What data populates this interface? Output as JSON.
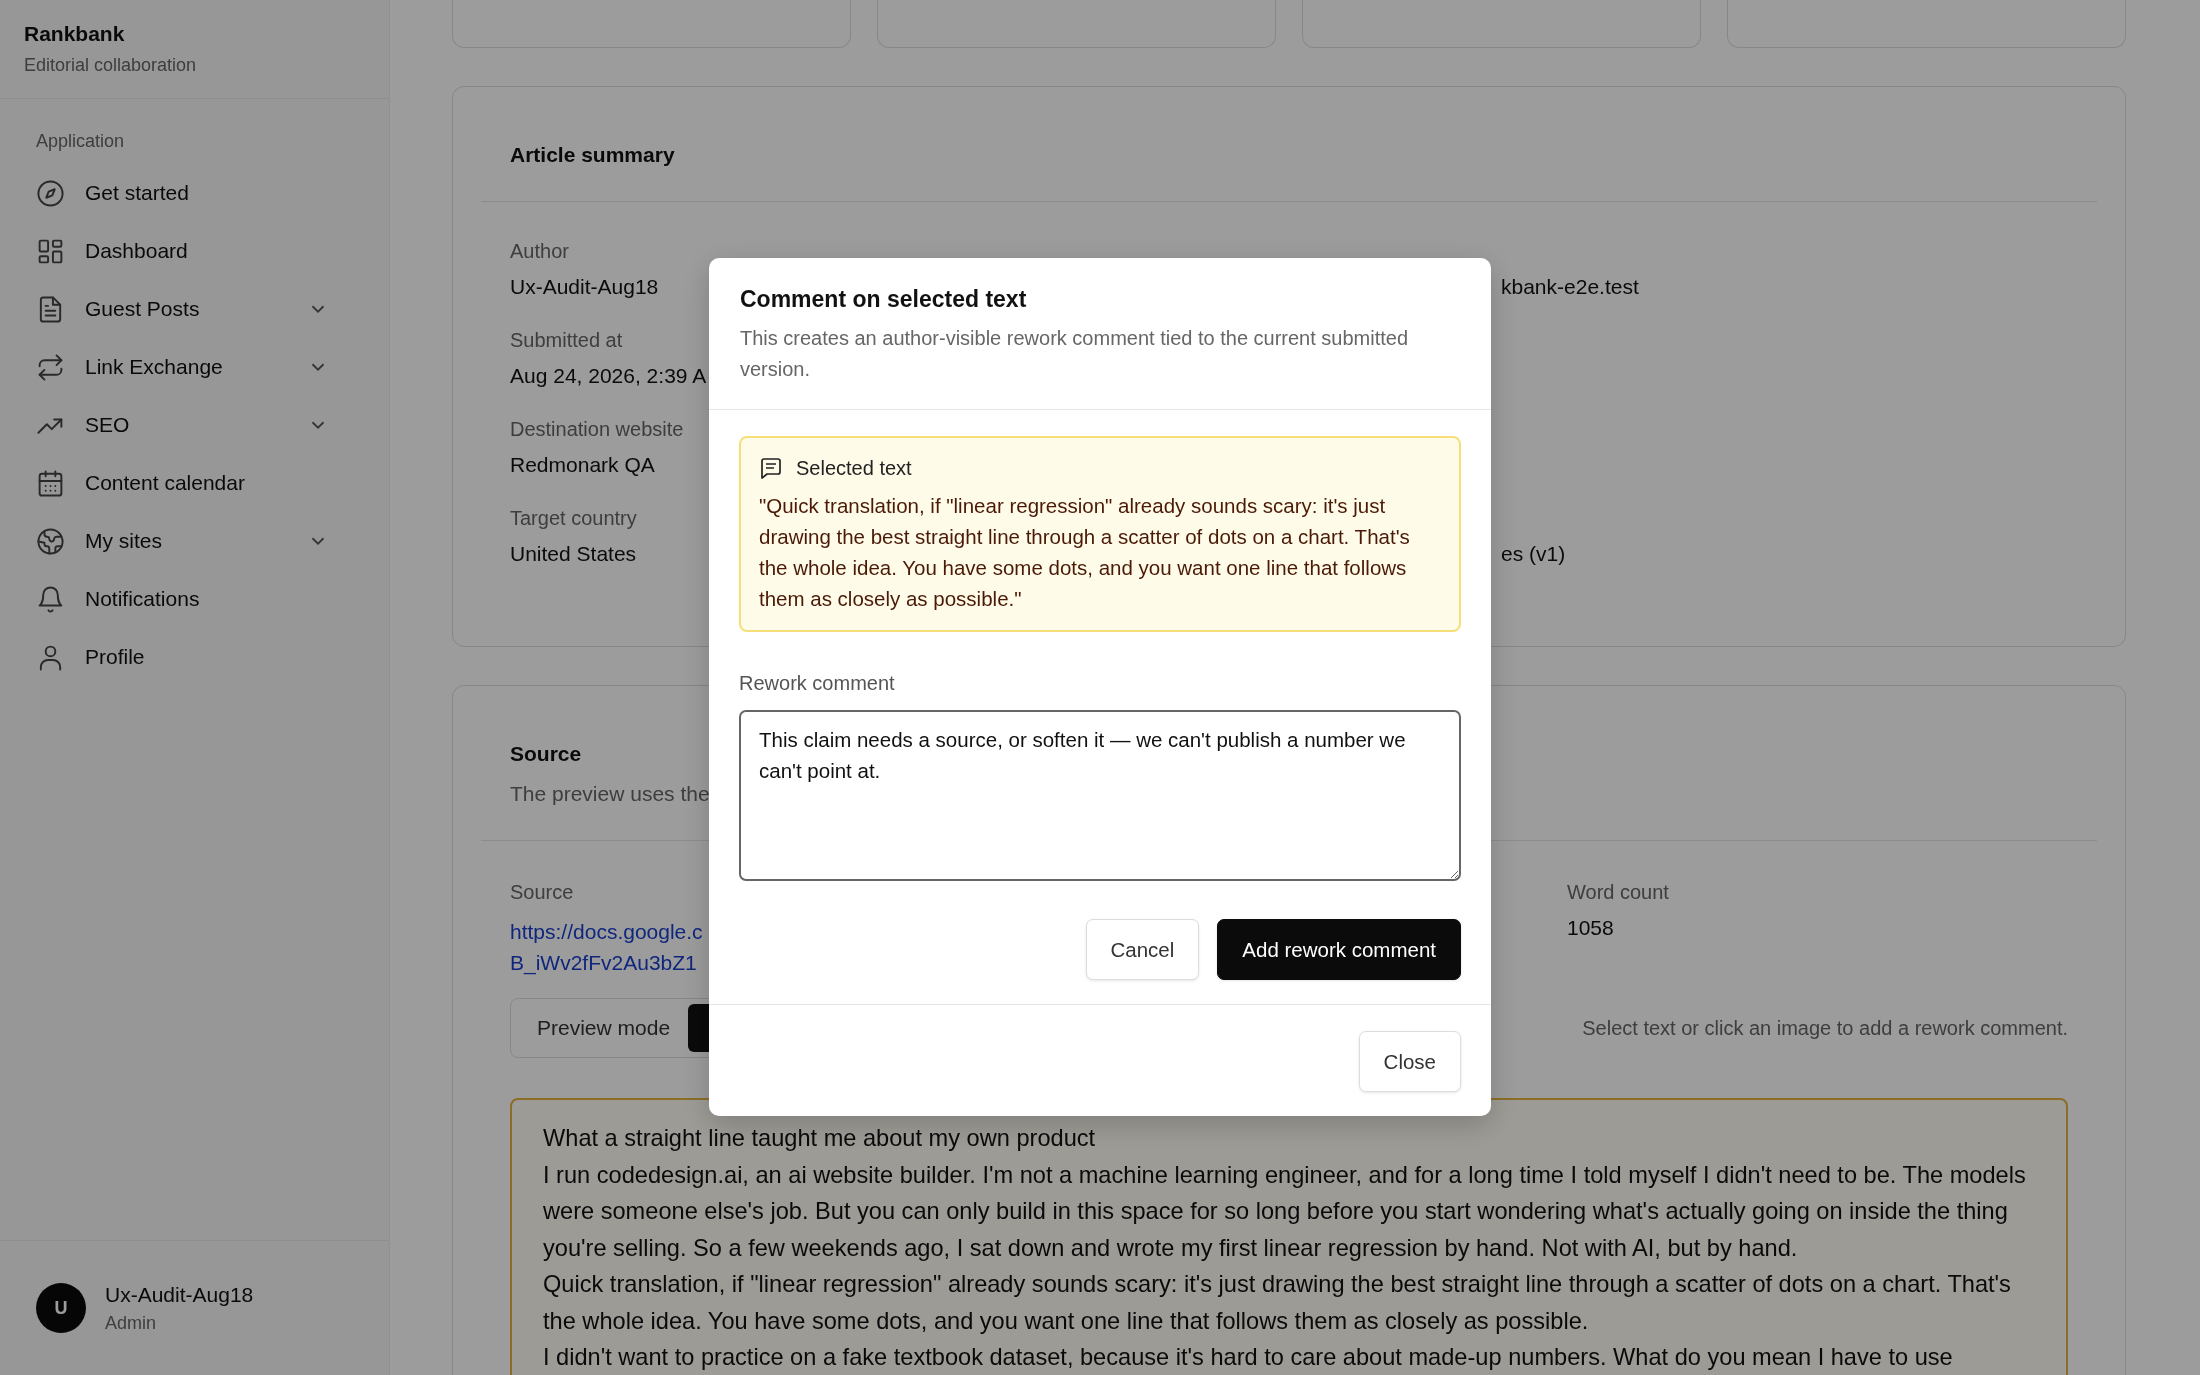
{
  "sidebar": {
    "brand": "Rankbank",
    "tagline": "Editorial collaboration",
    "section_label": "Application",
    "items": [
      {
        "label": "Get started",
        "expandable": false
      },
      {
        "label": "Dashboard",
        "expandable": false
      },
      {
        "label": "Guest Posts",
        "expandable": true
      },
      {
        "label": "Link Exchange",
        "expandable": true
      },
      {
        "label": "SEO",
        "expandable": true
      },
      {
        "label": "Content calendar",
        "expandable": false
      },
      {
        "label": "My sites",
        "expandable": true
      },
      {
        "label": "Notifications",
        "expandable": false
      },
      {
        "label": "Profile",
        "expandable": false
      }
    ],
    "user": {
      "initial": "U",
      "name": "Ux-Audit-Aug18",
      "role": "Admin"
    }
  },
  "summary": {
    "title": "Article summary",
    "fields": [
      {
        "label": "Author",
        "value": "Ux-Audit-Aug18",
        "right_value": "kbank-e2e.test"
      },
      {
        "label": "Submitted at",
        "value": "Aug 24, 2026, 2:39 A"
      },
      {
        "label": "Destination website",
        "value": "Redmonark QA"
      },
      {
        "label": "Target country",
        "value": "United States",
        "right_value": "es (v1)"
      }
    ]
  },
  "source": {
    "title": "Source",
    "subtitle": "The preview uses the",
    "source_label": "Source",
    "source_link": [
      "https://docs.google.c",
      "B_iWv2fFv2Au3bZ1"
    ],
    "word_count_label": "Word count",
    "word_count": "1058",
    "preview_mode_label": "Preview mode",
    "hint": "Select text or click an image to add a rework comment.",
    "article": [
      "What a straight line taught me about my own product",
      "I run codedesign.ai, an ai website builder. I'm not a machine learning engineer, and for a long time I told myself I didn't need to be. The models were someone else's job. But you can only build in this space for so long before you start wondering what's actually going on inside the thing you're selling. So a few weekends ago, I sat down and wrote my first linear regression by hand. Not with AI, but by hand.",
      "Quick translation, if \"linear regression\" already sounds scary: it's just drawing the best straight line through a scatter of dots on a chart. That's the whole idea. You have some dots, and you want one line that follows them as closely as possible.",
      "I didn't want to practice on a fake textbook dataset, because it's hard to care about made-up numbers. What do you mean I have to use"
    ]
  },
  "modal": {
    "title": "Comment on selected text",
    "description": "This creates an author-visible rework comment tied to the current submitted version.",
    "selected_label": "Selected text",
    "selected_quote": "\"Quick translation, if \"linear regression\" already sounds scary: it's just drawing the best straight line through a scatter of dots on a chart. That's the whole idea. You have some dots, and you want one line that follows them as closely as possible.\"",
    "comment_label": "Rework comment",
    "comment_value": "This claim needs a source, or soften it — we can't publish a number we can't point at.",
    "cancel": "Cancel",
    "submit": "Add rework comment",
    "close": "Close"
  }
}
